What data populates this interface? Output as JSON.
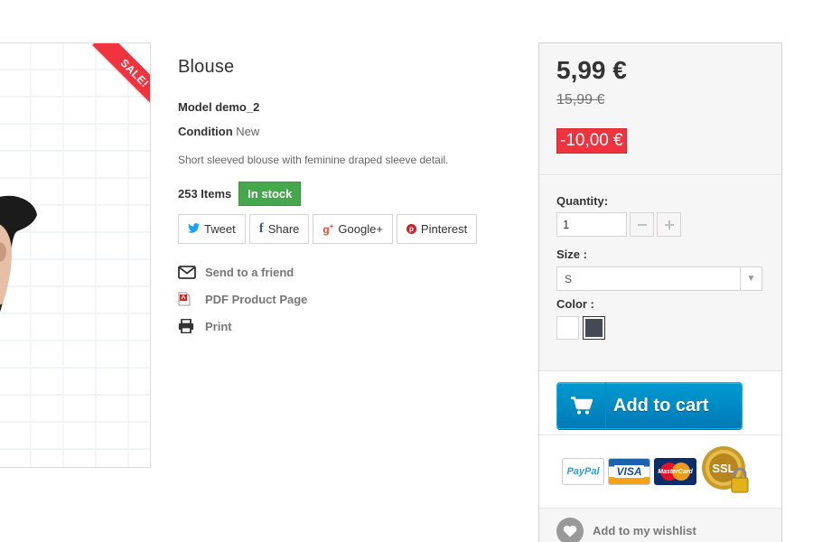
{
  "product": {
    "sale_ribbon": "SALE!",
    "title": "Blouse",
    "model_label": "Model",
    "model_value": "demo_2",
    "condition_label": "Condition",
    "condition_value": "New",
    "description": "Short sleeved blouse with feminine draped sleeve detail.",
    "items_count": "253 Items",
    "stock_status": "In stock"
  },
  "share": [
    {
      "label": "Tweet",
      "icon": "twitter-icon"
    },
    {
      "label": "Share",
      "icon": "facebook-icon"
    },
    {
      "label": "Google+",
      "icon": "google-plus-icon"
    },
    {
      "label": "Pinterest",
      "icon": "pinterest-icon"
    }
  ],
  "links": [
    {
      "label": "Send to a friend",
      "icon": "envelope-icon"
    },
    {
      "label": "PDF Product Page",
      "icon": "pdf-icon"
    },
    {
      "label": "Print",
      "icon": "printer-icon"
    }
  ],
  "buybox": {
    "price": "5,99 €",
    "old_price": "15,99 €",
    "reduction": "-10,00 €",
    "quantity_label": "Quantity:",
    "quantity_value": "1",
    "size_label": "Size :",
    "size_value": "S",
    "color_label": "Color :",
    "colors": [
      "#ffffff",
      "#434a54"
    ],
    "add_to_cart": "Add to cart",
    "wishlist": "Add to my wishlist",
    "payment": {
      "paypal": "PayPal",
      "visa": "VISA",
      "mastercard": "MasterCard",
      "ssl": "SSL"
    }
  },
  "colors": {
    "accent_red": "#f13340",
    "in_stock_green": "#46a74e",
    "cart_blue": "#0090c8"
  }
}
